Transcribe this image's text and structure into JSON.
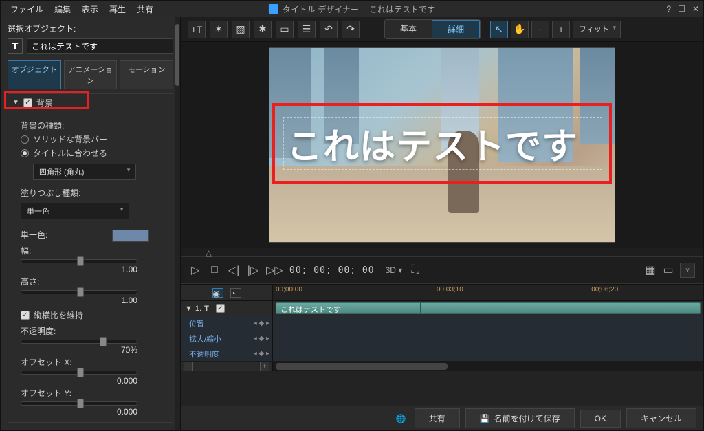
{
  "menu": {
    "file": "ファイル",
    "edit": "編集",
    "view": "表示",
    "play": "再生",
    "share": "共有"
  },
  "titlebar": {
    "app": "タイトル デザイナー",
    "sep": "|",
    "doc": "これはテストです"
  },
  "sidebar": {
    "selected_label": "選択オブジェクト:",
    "object_name": "これはテストです",
    "tabs": {
      "object": "オブジェクト",
      "animation": "アニメーション",
      "motion": "モーション"
    },
    "bg_section": {
      "title": "背景",
      "type_label": "背景の種類:",
      "radio_solid": "ソリッドな背景バー",
      "radio_fit": "タイトルに合わせる",
      "shape_select": "四角形 (角丸)",
      "fill_label": "塗りつぶし種類:",
      "fill_select": "単一色",
      "color_label": "単一色:",
      "color_hex": "#6d88a8",
      "width_label": "幅:",
      "width_val": "1.00",
      "height_label": "高さ:",
      "height_val": "1.00",
      "lock_aspect": "縦横比を維持",
      "opacity_label": "不透明度:",
      "opacity_val": "70%",
      "offx_label": "オフセット X:",
      "offx_val": "0.000",
      "offy_label": "オフセット Y:",
      "offy_val": "0.000"
    }
  },
  "toolbar": {
    "basic": "基本",
    "advanced": "詳細",
    "fit": "フィット"
  },
  "preview": {
    "title_text": "これはテストです"
  },
  "playback": {
    "timecode": "00; 00; 00; 00",
    "label3d": "3D"
  },
  "timeline": {
    "t0": "00;00;00",
    "t1": "00;03;10",
    "t2": "00;06;20",
    "track_main": "これはテストです",
    "row_pos": "位置",
    "row_scale": "拡大/縮小",
    "row_opacity": "不透明度"
  },
  "footer": {
    "share": "共有",
    "saveas": "名前を付けて保存",
    "ok": "OK",
    "cancel": "キャンセル"
  }
}
